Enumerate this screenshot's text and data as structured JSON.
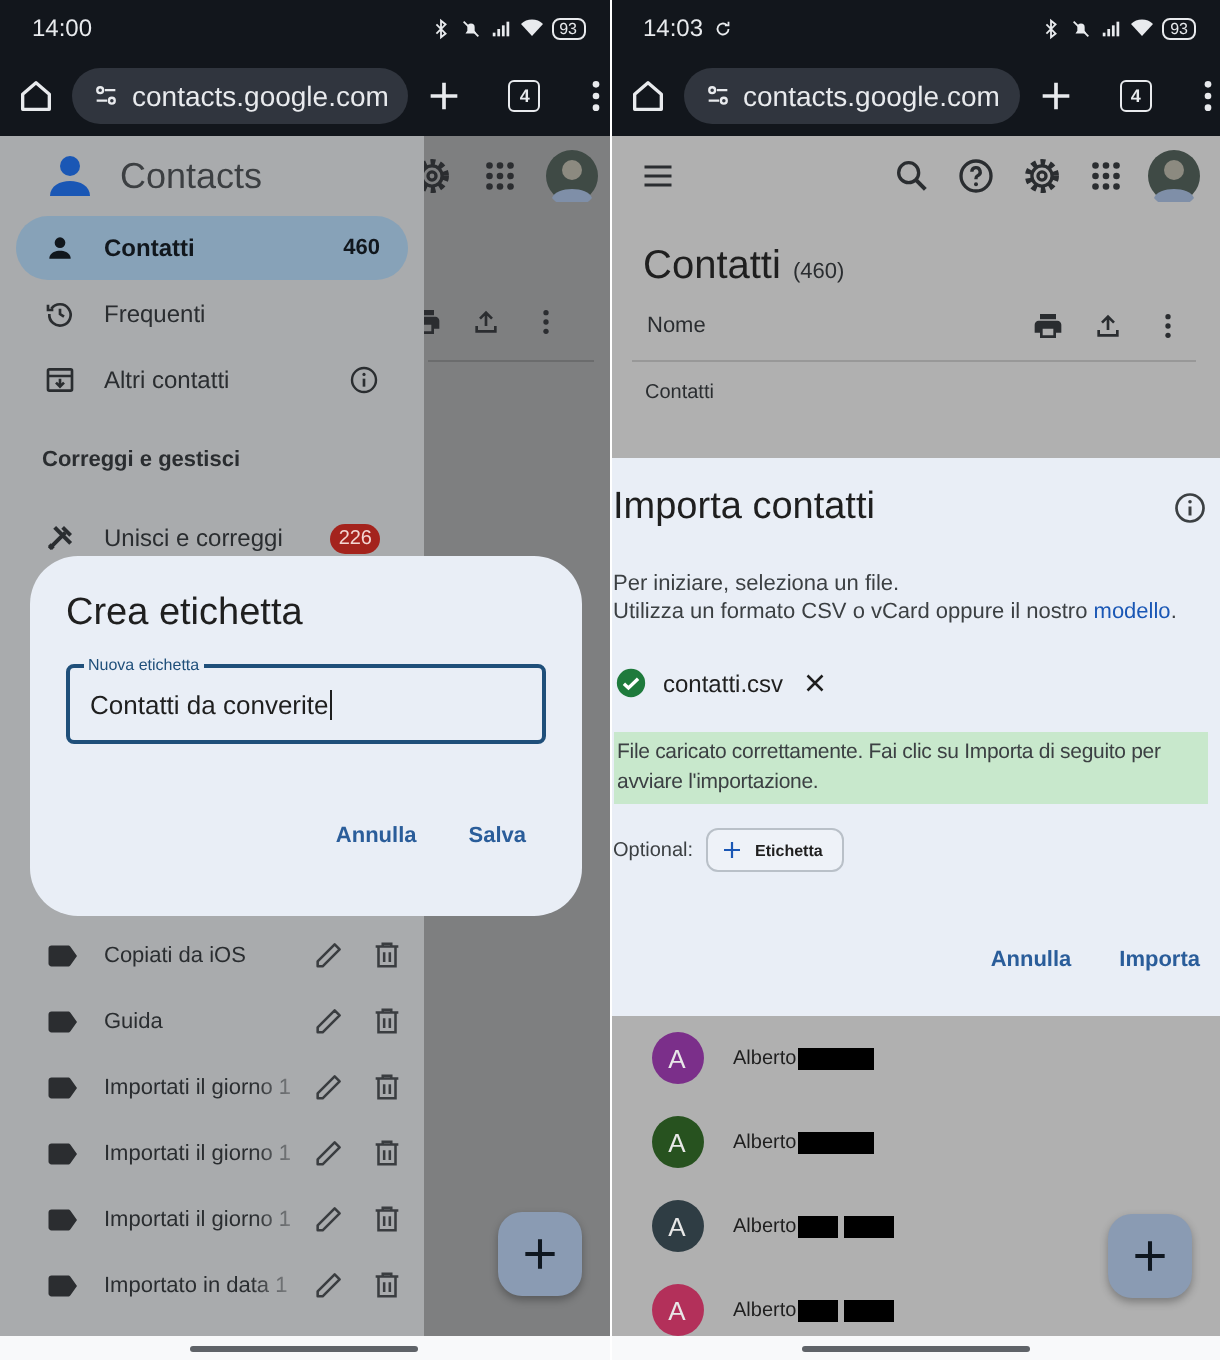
{
  "left_screen": {
    "status_bar": {
      "time": "14:00",
      "battery": "93"
    },
    "browser_bar": {
      "url": "contacts.google.com",
      "tab_count": "4"
    },
    "drawer": {
      "app_name": "Contacts",
      "items": [
        {
          "kind": "contacts",
          "label": "Contatti",
          "count": "460",
          "selected": true
        },
        {
          "kind": "frequent",
          "label": "Frequenti",
          "selected": false
        },
        {
          "kind": "other",
          "label": "Altri contatti",
          "info": true,
          "selected": false
        }
      ],
      "section_title": "Correggi e gestisci",
      "fix_items": [
        {
          "label": "Unisci e correggi",
          "badge": "226"
        }
      ],
      "labels": [
        {
          "name": "Copiati da iOS",
          "faded_end": false
        },
        {
          "name": "Guida",
          "faded_end": false
        },
        {
          "name": "Importati il giorno 1",
          "faded_end": true
        },
        {
          "name": "Importati il giorno 1",
          "faded_end": true
        },
        {
          "name": "Importati il giorno 1",
          "faded_end": true
        },
        {
          "name": "Importato in data 1",
          "faded_end": true
        }
      ]
    },
    "dialog": {
      "title": "Crea etichetta",
      "field": {
        "label": "Nuova etichetta",
        "value": "Contatti da converite",
        "focused": true
      },
      "buttons": [
        "Annulla",
        "Salva"
      ]
    }
  },
  "right_screen": {
    "status_bar": {
      "time": "14:03",
      "battery": "93"
    },
    "browser_bar": {
      "url": "contacts.google.com",
      "tab_count": "4"
    },
    "page": {
      "title": "Contatti",
      "count": "(460)",
      "column": "Nome",
      "section": "Contatti"
    },
    "dialog": {
      "title": "Importa contatti",
      "intro": "Per iniziare, seleziona un file.",
      "hint": "Utilizza un formato CSV o vCard oppure il nostro ",
      "link": "modello",
      "hint_end": ".",
      "file": {
        "name": "contatti.csv",
        "uploaded": true
      },
      "message": "File caricato correttamente. Fai clic su Importa di seguito per avviare l'importazione.",
      "optional_label": "Optional:",
      "chip": "Etichetta",
      "buttons": [
        "Annulla",
        "Importa"
      ]
    },
    "contacts": [
      {
        "initial": "A",
        "name": "Alberto",
        "color": "#7b2f8a",
        "kind": "one_redaction"
      },
      {
        "initial": "A",
        "name": "Alberto",
        "color": "#27521f",
        "kind": "one_redaction"
      },
      {
        "initial": "A",
        "name": "Alberto",
        "color": "#2f3d44",
        "kind": "two_redactions"
      },
      {
        "initial": "A",
        "name": "Alberto",
        "color": "#b3305a",
        "kind": "two_redactions"
      }
    ]
  }
}
